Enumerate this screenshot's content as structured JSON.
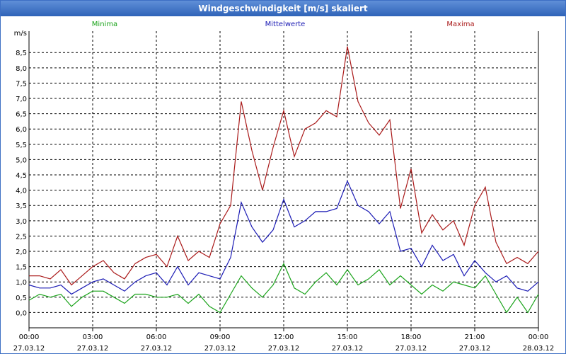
{
  "window": {
    "title": "Windgeschwindigkeit [m/s] skaliert"
  },
  "chart_data": {
    "type": "line",
    "ylabel": "m/s",
    "ylim": [
      -0.5,
      9.2
    ],
    "yticks": [
      0,
      0.5,
      1,
      1.5,
      2,
      2.5,
      3,
      3.5,
      4,
      4.5,
      5,
      5.5,
      6,
      6.5,
      7,
      7.5,
      8,
      8.5
    ],
    "ytick_labels": [
      "0,0",
      "0,5",
      "1,0",
      "1,5",
      "2,0",
      "2,5",
      "3,0",
      "3,5",
      "4,0",
      "4,5",
      "5,0",
      "5,5",
      "6,0",
      "6,5",
      "7,0",
      "7,5",
      "8,0",
      "8,5"
    ],
    "x_unit": "hours since 27.03.12 00:00",
    "xlim": [
      0,
      24
    ],
    "xticks": [
      {
        "time": "00:00",
        "date": "27.03.12"
      },
      {
        "time": "03:00",
        "date": "27.03.12"
      },
      {
        "time": "06:00",
        "date": "27.03.12"
      },
      {
        "time": "09:00",
        "date": "27.03.12"
      },
      {
        "time": "12:00",
        "date": "27.03.12"
      },
      {
        "time": "15:00",
        "date": "27.03.12"
      },
      {
        "time": "18:00",
        "date": "27.03.12"
      },
      {
        "time": "21:00",
        "date": "27.03.12"
      },
      {
        "time": "00:00",
        "date": "28.03.12"
      }
    ],
    "grid": true,
    "legend_position": "top",
    "x": [
      0,
      0.5,
      1,
      1.5,
      2,
      2.5,
      3,
      3.5,
      4,
      4.5,
      5,
      5.5,
      6,
      6.5,
      7,
      7.5,
      8,
      8.5,
      9,
      9.5,
      10,
      10.5,
      11,
      11.5,
      12,
      12.5,
      13,
      13.5,
      14,
      14.5,
      15,
      15.5,
      16,
      16.5,
      17,
      17.5,
      18,
      18.5,
      19,
      19.5,
      20,
      20.5,
      21,
      21.5,
      22,
      22.5,
      23,
      23.5,
      24
    ],
    "series": [
      {
        "name": "Minima",
        "color": "#1aa31a",
        "values": [
          0.4,
          0.6,
          0.5,
          0.6,
          0.2,
          0.5,
          0.7,
          0.7,
          0.5,
          0.3,
          0.6,
          0.6,
          0.5,
          0.5,
          0.6,
          0.3,
          0.6,
          0.2,
          0.0,
          0.6,
          1.2,
          0.8,
          0.5,
          0.9,
          1.6,
          0.8,
          0.6,
          1.0,
          1.3,
          0.9,
          1.4,
          0.9,
          1.1,
          1.4,
          0.9,
          1.2,
          0.9,
          0.6,
          0.9,
          0.7,
          1.0,
          0.9,
          0.8,
          1.2,
          0.6,
          0.0,
          0.5,
          0.0,
          0.6
        ]
      },
      {
        "name": "Mittelwerte",
        "color": "#1a1ab4",
        "values": [
          0.9,
          0.8,
          0.8,
          0.9,
          0.6,
          0.8,
          1.0,
          1.1,
          0.9,
          0.7,
          1.0,
          1.2,
          1.3,
          0.9,
          1.5,
          0.9,
          1.3,
          1.2,
          1.1,
          1.8,
          3.6,
          2.8,
          2.3,
          2.7,
          3.7,
          2.8,
          3.0,
          3.3,
          3.3,
          3.4,
          4.3,
          3.5,
          3.3,
          2.9,
          3.3,
          2.0,
          2.1,
          1.5,
          2.2,
          1.7,
          1.9,
          1.2,
          1.7,
          1.3,
          1.0,
          1.2,
          0.8,
          0.7,
          1.0
        ]
      },
      {
        "name": "Maxima",
        "color": "#aa1a1a",
        "values": [
          1.2,
          1.2,
          1.1,
          1.4,
          0.9,
          1.2,
          1.5,
          1.7,
          1.3,
          1.1,
          1.6,
          1.8,
          1.9,
          1.5,
          2.5,
          1.7,
          2.0,
          1.8,
          2.9,
          3.5,
          6.9,
          5.3,
          4.0,
          5.4,
          6.6,
          5.1,
          6.0,
          6.2,
          6.6,
          6.4,
          8.7,
          6.9,
          6.2,
          5.8,
          6.3,
          3.4,
          4.7,
          2.6,
          3.2,
          2.7,
          3.0,
          2.2,
          3.5,
          4.1,
          2.3,
          1.6,
          1.8,
          1.6,
          2.0
        ]
      }
    ]
  }
}
